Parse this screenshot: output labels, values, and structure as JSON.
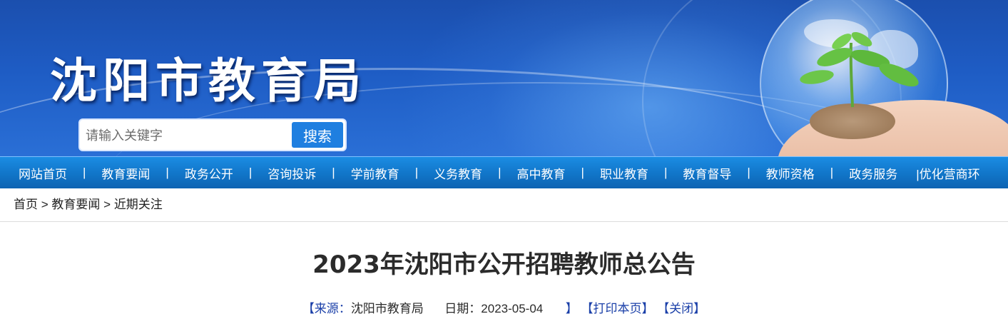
{
  "header": {
    "site_title": "沈阳市教育局",
    "search": {
      "placeholder": "请输入关键字",
      "button_label": "搜索"
    }
  },
  "nav": {
    "items": [
      "网站首页",
      "教育要闻",
      "政务公开",
      "咨询投诉",
      "学前教育",
      "义务教育",
      "高中教育",
      "职业教育",
      "教育督导",
      "教师资格",
      "政务服务",
      "|优化营商环"
    ],
    "separator": "|"
  },
  "breadcrumb": {
    "items": [
      "首页",
      "教育要闻",
      "近期关注"
    ],
    "separator": ">"
  },
  "article": {
    "title": "2023年沈阳市公开招聘教师总公告",
    "meta": {
      "source_label": "【来源：",
      "source_value": "沈阳市教育局",
      "date_label": "日期：",
      "date_value": "2023-05-04",
      "close_bracket": "】",
      "print_label": "【打印本页】",
      "close_label": "【关闭】"
    }
  },
  "colors": {
    "banner": "#1e5cc4",
    "nav": "#1175c8",
    "search_button": "#1f7fe0",
    "meta_link": "#1a3fa8"
  }
}
